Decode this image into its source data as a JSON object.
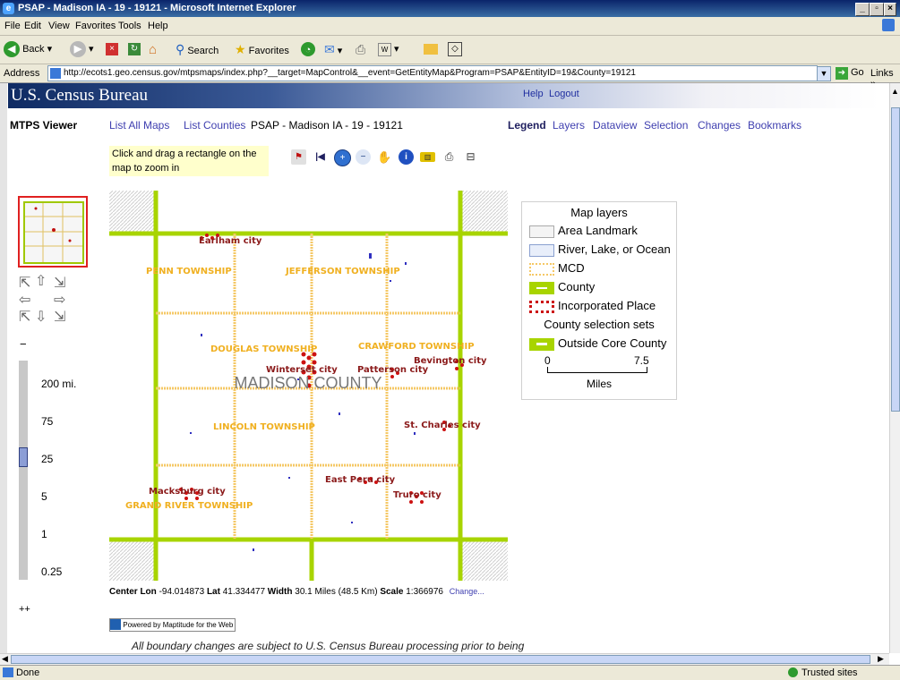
{
  "window": {
    "title": "PSAP - Madison IA - 19 - 19121 - Microsoft Internet Explorer"
  },
  "menu": [
    "File",
    "Edit",
    "View",
    "Favorites",
    "Tools",
    "Help"
  ],
  "toolbar": {
    "back": "Back",
    "search": "Search",
    "favorites": "Favorites"
  },
  "address": {
    "label": "Address",
    "url": "http://ecots1.geo.census.gov/mtpsmaps/index.php?__target=MapControl&__event=GetEntityMap&Program=PSAP&EntityID=19&County=19121",
    "go": "Go",
    "links": "Links"
  },
  "page": {
    "banner_title": "U.S. Census Bureau",
    "help": "Help",
    "logout": "Logout",
    "viewer": "MTPS Viewer",
    "list_maps": "List All Maps",
    "list_counties": "List Counties",
    "breadcrumb": "PSAP - Madison IA - 19 - 19121",
    "tabs": [
      "Legend",
      "Layers",
      "Dataview",
      "Selection",
      "Changes",
      "Bookmarks"
    ],
    "hint": "Click and drag a rectangle on the map to zoom in"
  },
  "zoom_levels": [
    "200 mi.",
    "75",
    "25",
    "5",
    "1",
    "0.25"
  ],
  "zoom_minus": "−",
  "zoom_plus": "++",
  "map": {
    "county_label": "MADISON COUNTY",
    "townships": [
      "PENN TOWNSHIP",
      "JEFFERSON TOWNSHIP",
      "DOUGLAS TOWNSHIP",
      "CRAWFORD TOWNSHIP",
      "LINCOLN TOWNSHIP",
      "GRAND RIVER TOWNSHIP"
    ],
    "places": [
      "Earlham city",
      "Winterset city",
      "Patterson city",
      "Bevington city",
      "St. Charles city",
      "East Peru city",
      "Truro city",
      "Macksburg city"
    ]
  },
  "legend": {
    "title": "Map layers",
    "items": [
      "Area Landmark",
      "River, Lake, or Ocean",
      "MCD",
      "County",
      "Incorporated Place"
    ],
    "sets_title": "County selection sets",
    "sets_items": [
      "Outside Core County"
    ],
    "scale_min": "0",
    "scale_max": "7.5",
    "scale_unit": "Miles",
    "colors": {
      "county": "#a8d400",
      "mcd": "#f5c866",
      "place": "#cc1111",
      "water": "#3030c0"
    }
  },
  "footer": {
    "center_lon_label": "Center Lon",
    "center_lon": "-94.014873",
    "lat_label": "Lat",
    "lat": "41.334477",
    "width_label": "Width",
    "width": "30.1 Miles (48.5 Km)",
    "scale_label": "Scale",
    "scale": "1:366976",
    "change": "Change...",
    "powered": "Powered by Maptitude for the Web",
    "notice": "All boundary changes are subject to U.S. Census Bureau processing prior to being"
  },
  "status": {
    "text": "Done",
    "zone": "Trusted sites"
  }
}
